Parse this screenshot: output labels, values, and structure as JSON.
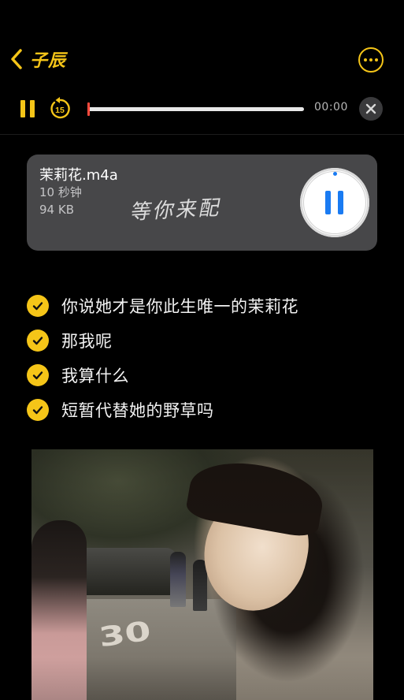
{
  "nav": {
    "back_label": "子辰",
    "back_icon": "chevron-left-icon",
    "more_icon": "ellipsis-circle-icon"
  },
  "player": {
    "pause_icon": "pause-icon",
    "rewind_icon": "skip-back-15-icon",
    "rewind_seconds": "15",
    "elapsed": "00:00",
    "progress_fraction": 0.0,
    "close_icon": "close-icon"
  },
  "attachment": {
    "file_name": "茉莉花.m4a",
    "duration": "10 秒钟",
    "size": "94 KB",
    "cover_text": "等你来配",
    "play_state_icon": "pause-icon"
  },
  "checklist": {
    "items": [
      {
        "text": "你说她才是你此生唯一的茉莉花",
        "checked": true
      },
      {
        "text": "那我呢",
        "checked": true
      },
      {
        "text": "我算什么",
        "checked": true
      },
      {
        "text": "短暂代替她的野草吗",
        "checked": true
      }
    ]
  },
  "photo": {
    "street_marking": "30"
  },
  "colors": {
    "accent": "#f5c518",
    "play_blue": "#1a7bf2",
    "progress_red": "#ff4a3d",
    "card_bg": "#474749",
    "background": "#000000"
  }
}
